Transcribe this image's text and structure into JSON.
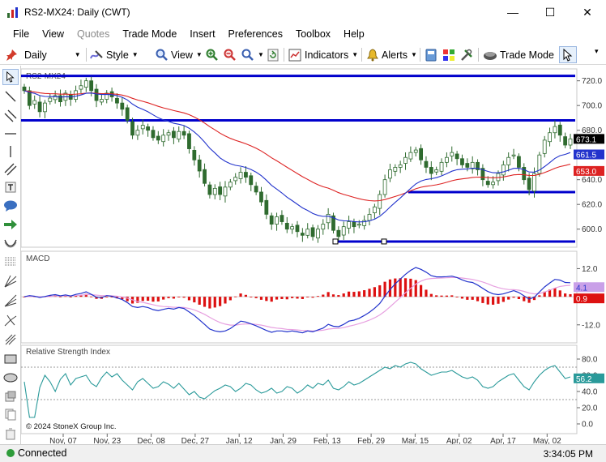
{
  "window": {
    "title": "RS2-MX24: Daily (CWT)",
    "minimize_glyph": "—",
    "maximize_glyph": "☐",
    "close_glyph": "✕"
  },
  "menu": [
    "File",
    "View",
    "Quotes",
    "Trade Mode",
    "Insert",
    "Preferences",
    "Toolbox",
    "Help"
  ],
  "menu_disabled": [
    "Quotes"
  ],
  "toolbar": {
    "interval": "Daily",
    "style": "Style",
    "view": "View",
    "indicators": "Indicators",
    "alerts": "Alerts",
    "trade_mode": "Trade Mode"
  },
  "colors": {
    "candle": "#2f6b2f",
    "blue_line": "#2233cc",
    "red_line": "#dd2222",
    "hline": "#0000cc",
    "macd_hist": "#dd1111",
    "macd_line": "#2233cc",
    "macd_signal": "#e7a0e0",
    "rsi_line": "#2a9a9a",
    "last_price_bg": "#000000",
    "blue_badge": "#2233cc",
    "red_badge": "#dd2222"
  },
  "chart_data": [
    {
      "type": "candlestick",
      "title": "RS2-MX24",
      "y_ticks": [
        600,
        620,
        640,
        660,
        680,
        700,
        720
      ],
      "ylim": [
        588,
        727
      ],
      "horizontal_lines": [
        724,
        688,
        630,
        590
      ],
      "badges": {
        "last_price": "673.1",
        "blue_ma": "661.5",
        "red_ma": "653.0"
      },
      "x_labels": [
        "Nov, 07",
        "Nov, 23",
        "Dec, 08",
        "Dec, 27",
        "Jan, 12",
        "Jan, 29",
        "Feb, 13",
        "Feb, 29",
        "Mar, 15",
        "Apr, 02",
        "Apr, 17",
        "May, 02"
      ],
      "close": [
        712,
        700,
        704,
        695,
        702,
        706,
        708,
        703,
        710,
        705,
        712,
        716,
        720,
        712,
        704,
        705,
        710,
        707,
        702,
        697,
        688,
        676,
        680,
        684,
        680,
        674,
        672,
        676,
        678,
        674,
        679,
        676,
        665,
        656,
        647,
        637,
        628,
        633,
        628,
        634,
        638,
        642,
        646,
        642,
        636,
        630,
        622,
        612,
        604,
        610,
        606,
        600,
        602,
        598,
        595,
        600,
        594,
        600,
        604,
        612,
        599,
        594,
        602,
        606,
        602,
        604,
        607,
        612,
        618,
        628,
        640,
        648,
        650,
        652,
        658,
        662,
        664,
        656,
        650,
        645,
        648,
        654,
        658,
        662,
        657,
        652,
        650,
        654,
        648,
        640,
        636,
        638,
        645,
        652,
        658,
        660,
        650,
        640,
        632,
        645,
        660,
        672,
        678,
        683,
        676,
        668,
        673
      ]
    },
    {
      "type": "line",
      "title": "MACD",
      "y_ticks": [
        12.0,
        0.0,
        -12.0
      ],
      "ylim": [
        -19,
        17
      ],
      "badges": {
        "macd": "4.1",
        "signal": "0.9"
      },
      "macd": [
        0,
        0.5,
        0.2,
        -0.3,
        0.1,
        0.6,
        0.9,
        0.4,
        0.8,
        0.3,
        1.0,
        1.4,
        2.1,
        1.0,
        -0.2,
        -0.4,
        0.5,
        0.2,
        -0.5,
        -1.2,
        -2.5,
        -4.2,
        -4.6,
        -4.2,
        -4.6,
        -5.5,
        -5.9,
        -5.4,
        -4.9,
        -5.3,
        -4.6,
        -5.0,
        -6.5,
        -8.0,
        -9.9,
        -11.8,
        -13.8,
        -14.6,
        -15.0,
        -14.6,
        -13.6,
        -12.0,
        -10.4,
        -10.8,
        -11.6,
        -12.4,
        -13.4,
        -14.4,
        -15.2,
        -14.6,
        -14.6,
        -15.0,
        -14.6,
        -15.0,
        -15.4,
        -14.6,
        -15.0,
        -14.2,
        -13.4,
        -11.8,
        -12.6,
        -12.8,
        -11.8,
        -10.4,
        -10.0,
        -9.2,
        -8.0,
        -6.6,
        -4.9,
        -2.9,
        0.2,
        3.1,
        5.5,
        7.6,
        9.6,
        11.3,
        12.5,
        11.7,
        10.5,
        9.0,
        8.5,
        8.5,
        8.6,
        8.8,
        8.2,
        7.2,
        6.4,
        6.1,
        5.0,
        3.6,
        2.2,
        1.2,
        0.9,
        1.2,
        1.9,
        2.6,
        1.8,
        0.4,
        -1.0,
        -0.2,
        2.0,
        4.2,
        5.9,
        7.4,
        7.1,
        6.1,
        6.0
      ],
      "signal": [
        0,
        0.1,
        0.1,
        0.0,
        0.0,
        0.1,
        0.3,
        0.3,
        0.4,
        0.4,
        0.5,
        0.7,
        0.9,
        0.9,
        0.7,
        0.5,
        0.5,
        0.4,
        0.2,
        -0.1,
        -0.6,
        -1.3,
        -2.0,
        -2.4,
        -2.9,
        -3.4,
        -3.9,
        -4.2,
        -4.3,
        -4.5,
        -4.5,
        -4.6,
        -5.0,
        -5.6,
        -6.5,
        -7.5,
        -8.8,
        -10.0,
        -11.0,
        -11.7,
        -12.1,
        -12.1,
        -11.8,
        -11.6,
        -11.6,
        -11.8,
        -12.1,
        -12.6,
        -13.1,
        -13.4,
        -13.6,
        -13.9,
        -14.0,
        -14.2,
        -14.4,
        -14.5,
        -14.6,
        -14.5,
        -14.3,
        -13.8,
        -13.6,
        -13.5,
        -13.2,
        -12.6,
        -12.1,
        -11.5,
        -10.8,
        -10.0,
        -9.0,
        -7.8,
        -6.2,
        -4.3,
        -2.3,
        -0.3,
        1.7,
        3.6,
        5.4,
        6.7,
        7.5,
        7.8,
        7.9,
        8.0,
        8.1,
        8.2,
        8.2,
        8.0,
        7.7,
        7.4,
        6.9,
        6.3,
        5.5,
        4.6,
        3.9,
        3.4,
        3.1,
        3.0,
        2.8,
        2.3,
        1.6,
        1.2,
        1.4,
        2.0,
        2.8,
        3.7,
        4.4,
        4.7,
        4.9
      ]
    },
    {
      "type": "line",
      "title": "Relative Strength Index",
      "y_ticks": [
        80.0,
        60.0,
        40.0,
        20.0,
        0.0
      ],
      "ylim": [
        -10,
        92
      ],
      "reference_lines": [
        70,
        30
      ],
      "badge": "56.2",
      "copyright": "© 2024 StoneX Group Inc.",
      "rsi": [
        52,
        8,
        8,
        45,
        60,
        52,
        40,
        55,
        62,
        48,
        56,
        58,
        60,
        50,
        46,
        57,
        64,
        58,
        62,
        54,
        48,
        42,
        52,
        56,
        50,
        44,
        46,
        52,
        49,
        44,
        50,
        43,
        36,
        40,
        33,
        31,
        36,
        41,
        44,
        48,
        46,
        40,
        44,
        50,
        48,
        42,
        38,
        40,
        44,
        38,
        40,
        46,
        44,
        38,
        42,
        48,
        44,
        50,
        48,
        54,
        44,
        42,
        46,
        52,
        48,
        50,
        54,
        58,
        62,
        66,
        70,
        68,
        72,
        70,
        74,
        76,
        74,
        68,
        64,
        60,
        62,
        64,
        64,
        66,
        62,
        58,
        56,
        58,
        54,
        46,
        44,
        46,
        52,
        56,
        60,
        62,
        54,
        46,
        42,
        52,
        60,
        66,
        70,
        72,
        64,
        56,
        58
      ]
    }
  ],
  "status": {
    "connection": "Connected",
    "time": "3:34:05 PM"
  }
}
